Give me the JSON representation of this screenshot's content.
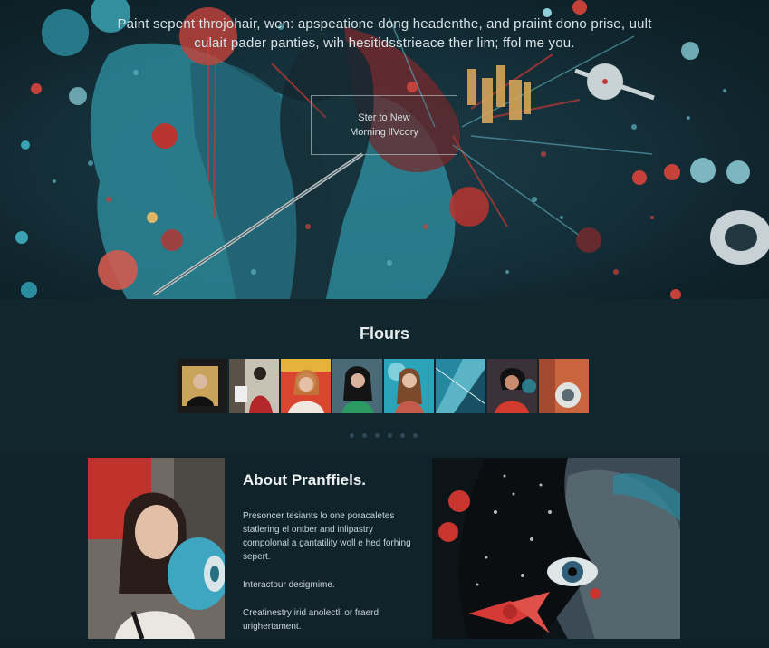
{
  "hero": {
    "line1": "Paint sepent throjohair, wen: apspeatione dong headenthe, and praiint dono prise, uult",
    "line2": "culait pader panties, wih hesitidsstrieace ther lim; ffol me you.",
    "cta_line1": "Ster to New",
    "cta_line2": "Morning llVcory"
  },
  "gallery": {
    "title": "Flours",
    "thumbnails": [
      {
        "label": "portrait-1"
      },
      {
        "label": "portrait-2"
      },
      {
        "label": "portrait-3"
      },
      {
        "label": "portrait-4"
      },
      {
        "label": "portrait-5"
      },
      {
        "label": "abstract-6"
      },
      {
        "label": "portrait-7"
      },
      {
        "label": "object-8"
      }
    ],
    "dots_count": 6
  },
  "about": {
    "title": "About Pranffiels.",
    "para1": "Presoncer tesiants lo one poracaletes statlering el ontber and inlipastry compolonal a gantatility woll e hed forhing sepert.",
    "para2": "Interactour desigmime.",
    "para3": "Creatinestry irid anolectli or fraerd urighertament."
  },
  "colors": {
    "background": "#0f2128",
    "teal_accent": "#2a8a9c",
    "red_accent": "#c23a35",
    "text": "#dfe6e8"
  }
}
